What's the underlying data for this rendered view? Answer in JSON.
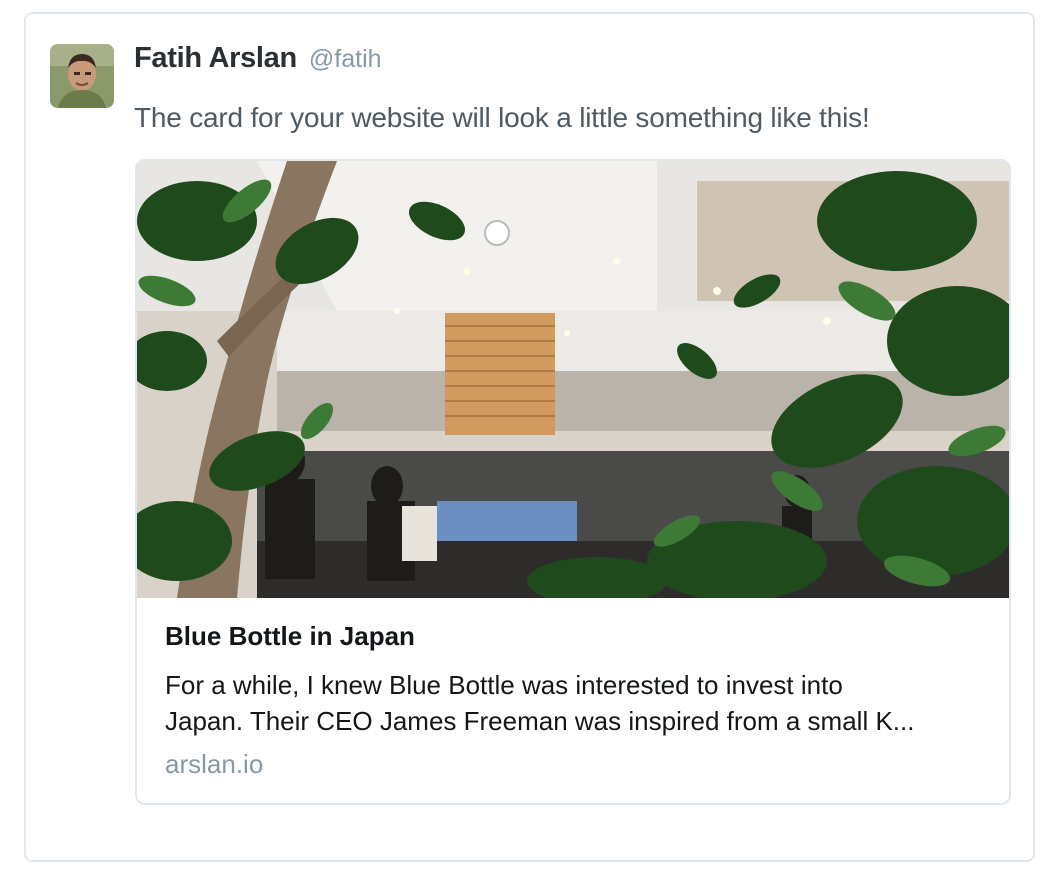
{
  "tweet": {
    "author": {
      "fullname": "Fatih Arslan",
      "username": "@fatih",
      "avatar_icon": "user-avatar-photo"
    },
    "text": "The card for your website will look a little something like this!",
    "card": {
      "image_description_icon": "cafe-interior-photo",
      "title": "Blue Bottle in Japan",
      "description_lines": [
        "For a while, I knew Blue Bottle was interested to invest into",
        "Japan. Their CEO James Freeman was inspired from a small K..."
      ],
      "domain": "arslan.io"
    }
  },
  "colors": {
    "border": "#e1e8ed",
    "name": "#292f33",
    "secondary": "#8899a6",
    "text": "#4f5a62",
    "card_text": "#14171a"
  }
}
